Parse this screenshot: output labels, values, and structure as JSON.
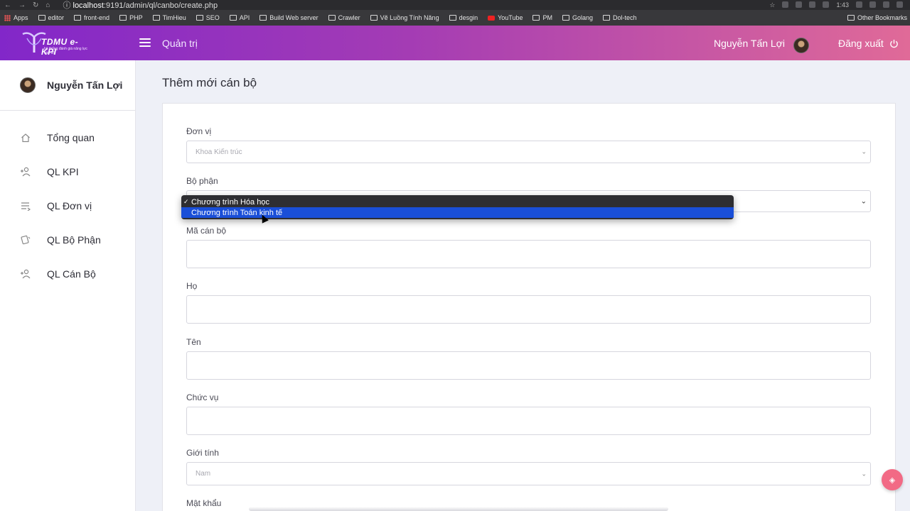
{
  "browser": {
    "url_host": "localhost",
    "url_rest": ":9191/admin/ql/canbo/create.php",
    "bookmarks": [
      "Apps",
      "editor",
      "front-end",
      "PHP",
      "TimHieu",
      "SEO",
      "API",
      "Build Web server",
      "Crawler",
      "Vẽ Luồng Tính Năng",
      "desgin",
      "YouTube",
      "PM",
      "Golang",
      "Dol-tech"
    ],
    "other_bookmarks": "Other Bookmarks",
    "ext_badge": "1:43"
  },
  "header": {
    "logo_text": "TDMU e-KPI",
    "logo_sub": "hệ thống đánh giá năng lực cán bộ",
    "section": "Quản trị",
    "user_name": "Nguyễn Tấn Lợi",
    "logout_label": "Đăng xuất"
  },
  "sidebar": {
    "user_name": "Nguyễn Tấn Lợi",
    "items": [
      {
        "label": "Tổng quan",
        "icon": "home-icon"
      },
      {
        "label": "QL KPI",
        "icon": "user-add-icon"
      },
      {
        "label": "QL Đơn vị",
        "icon": "list-icon"
      },
      {
        "label": "QL Bộ Phận",
        "icon": "badge-icon"
      },
      {
        "label": "QL Cán Bộ",
        "icon": "user-add-icon"
      }
    ]
  },
  "form": {
    "title": "Thêm mới cán bộ",
    "don_vi_label": "Đơn vị",
    "don_vi_value": "Khoa Kiến trúc",
    "bo_phan_label": "Bộ phận",
    "bo_phan_options": [
      "Chương trình Hóa học",
      "Chương trình Toán kinh tế"
    ],
    "ma_can_bo_label": "Mã cán bộ",
    "ho_label": "Họ",
    "ten_label": "Tên",
    "chuc_vu_label": "Chức vụ",
    "gioi_tinh_label": "Giới tính",
    "gioi_tinh_value": "Nam",
    "mat_khau_label": "Mật khẩu"
  }
}
